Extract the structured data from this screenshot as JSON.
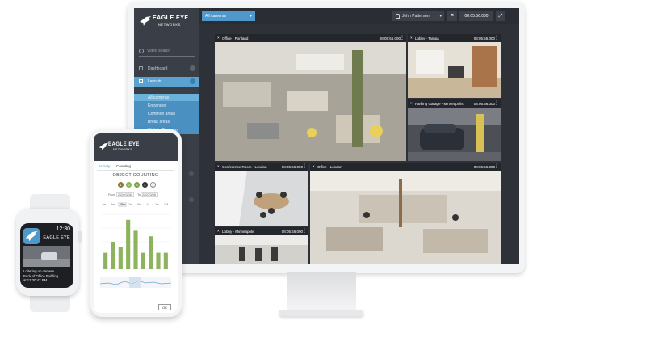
{
  "brand": {
    "line1": "EAGLE EYE",
    "line2": "NETWORKS"
  },
  "sidebar": {
    "search_placeholder": "Video search",
    "items": [
      {
        "label": "Dashboard"
      },
      {
        "label": "Layouts"
      }
    ],
    "layouts": [
      "All cameras",
      "Entrances",
      "Common areas",
      "Break areas",
      "High traffic areas"
    ]
  },
  "topbar": {
    "camera_select": "All cameras",
    "user": "John Patterson",
    "time": "08:05:56.000"
  },
  "cameras": [
    {
      "name": "Office - Portland",
      "time": "08:05:56.000"
    },
    {
      "name": "Lobby - Tampa",
      "time": "08:05:56.000"
    },
    {
      "name": "Parking Garage - Minneapolis",
      "time": "08:05:56.000"
    },
    {
      "name": "Conference Room - London",
      "time": "08:05:56.000"
    },
    {
      "name": "Office - London",
      "time": "08:05:56.000"
    },
    {
      "name": "Lobby - Minneapolis",
      "time": "08:05:56.000"
    }
  ],
  "phone": {
    "tabs": [
      "Activity",
      "Counting"
    ],
    "title": "OBJECT COUNTING",
    "from_label": "From",
    "from_date": "2020/3/06",
    "to_label": "To",
    "to_date": "2020/3/08",
    "periods": [
      "1m",
      "5m",
      "15m",
      "1h",
      "6h",
      "1d",
      "1w",
      "1M"
    ],
    "active_period": "15m",
    "ok": "OK"
  },
  "chart_data": {
    "type": "bar",
    "values": [
      3,
      5,
      4,
      9,
      7,
      3,
      6,
      3,
      3
    ],
    "ylim": [
      0,
      10
    ],
    "grid": true
  },
  "watch": {
    "time": "12:30",
    "brand": "EAGLE EYE",
    "message": [
      "Loitering on camera",
      "Back of Office Building",
      "at 12:30:42 PM"
    ]
  },
  "colors": {
    "accent": "#4e98cb",
    "sidebar_bg": "#3a3e46",
    "bar": "#8db45c"
  }
}
